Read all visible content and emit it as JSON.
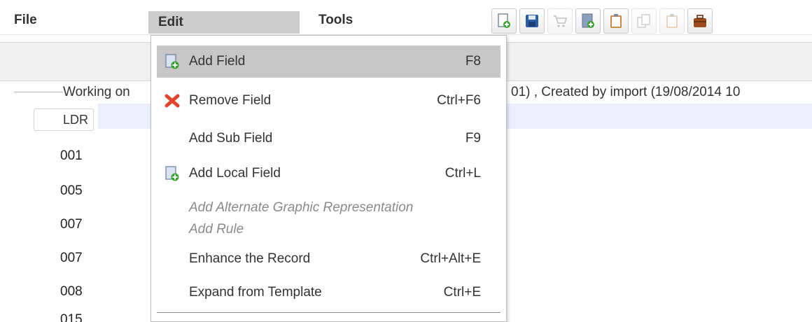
{
  "menubar": {
    "items": [
      {
        "label": "File"
      },
      {
        "label": "Edit"
      },
      {
        "label": "Tools"
      }
    ]
  },
  "toolbar": {
    "buttons": [
      {
        "icon": "new-record-icon",
        "enabled": true
      },
      {
        "icon": "save-icon",
        "enabled": true
      },
      {
        "icon": "cart-icon",
        "enabled": false
      },
      {
        "icon": "document-add-icon",
        "enabled": true
      },
      {
        "icon": "clipboard-icon",
        "enabled": true
      },
      {
        "icon": "copy-icon",
        "enabled": false
      },
      {
        "icon": "clipboard-blank-icon",
        "enabled": false
      },
      {
        "icon": "briefcase-icon",
        "enabled": true
      }
    ]
  },
  "record": {
    "working_on_prefix": "Working on",
    "working_on_suffix": "01) , Created by import (19/08/2014 10",
    "leader_tag": "LDR",
    "tags": [
      "001",
      "005",
      "007",
      "007",
      "008",
      "015"
    ]
  },
  "edit_menu": {
    "items": [
      {
        "label": "Add Field",
        "shortcut": "F8",
        "icon": "add-field-icon",
        "selected": true
      },
      {
        "label": "Remove Field",
        "shortcut": "Ctrl+F6",
        "icon": "remove-x-icon"
      },
      {
        "label": "Add Sub Field",
        "shortcut": "F9",
        "icon": ""
      },
      {
        "label": "Add Local Field",
        "shortcut": "Ctrl+L",
        "icon": "add-field-icon"
      },
      {
        "label": "Add Alternate Graphic Representation",
        "shortcut": "",
        "disabled": true
      },
      {
        "label": "Add Rule",
        "shortcut": "",
        "disabled": true
      },
      {
        "label": "Enhance the Record",
        "shortcut": "Ctrl+Alt+E",
        "icon": ""
      },
      {
        "label": "Expand from Template",
        "shortcut": "Ctrl+E",
        "icon": ""
      }
    ]
  },
  "colors": {
    "selected_bg": "#c7c7c7",
    "highlight_band": "#eceefb",
    "remove_red": "#e0452c",
    "add_green": "#3aa32f"
  }
}
